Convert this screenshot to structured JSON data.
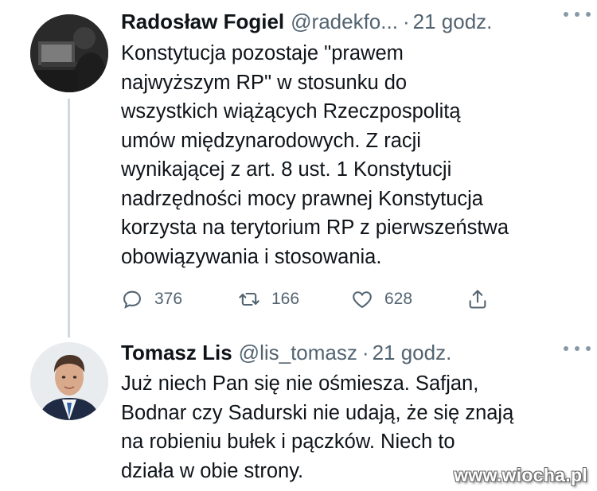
{
  "tweets": [
    {
      "name": "Radosław Fogiel",
      "handle": "@radekfo...",
      "time": "21 godz.",
      "lines": [
        "Konstytucja pozostaje \"prawem",
        "najwyższym RP\" w stosunku do",
        "wszystkich wiążących Rzeczpospolitą",
        "umów międzynarodowych. Z racji",
        "wynikającej z art. 8 ust. 1 Konstytucji",
        "nadrzędności mocy prawnej Konstytucja",
        "korzysta na terytorium RP z pierwszeństwa",
        "obowiązywania i stosowania."
      ],
      "replies": "376",
      "retweets": "166",
      "likes": "628"
    },
    {
      "name": "Tomasz Lis",
      "handle": "@lis_tomasz",
      "time": "21 godz.",
      "lines": [
        "Już niech Pan się nie ośmiesza. Safjan,",
        "Bodnar czy Sadurski nie udają, że się znają",
        "na robieniu bułek i pączków. Niech to",
        "działa w obie strony."
      ]
    }
  ],
  "watermark": "www.wiocha.pl"
}
